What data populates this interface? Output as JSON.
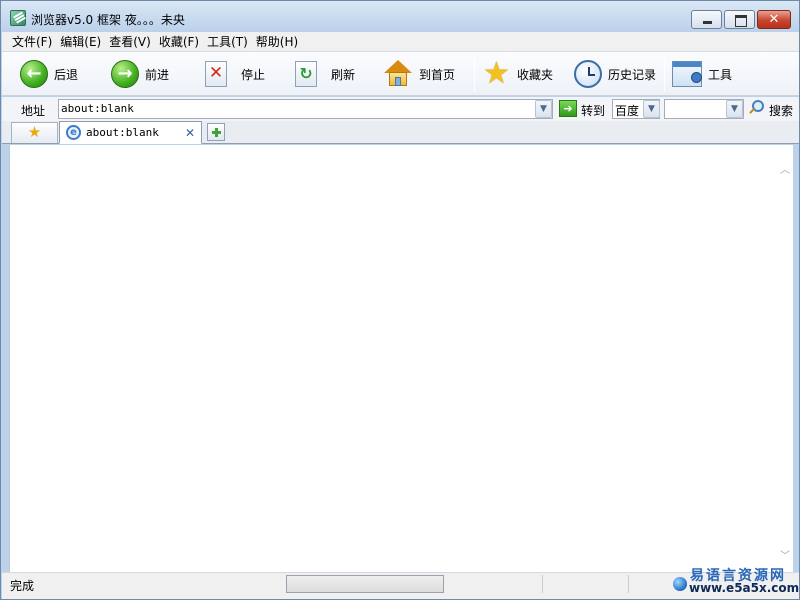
{
  "window": {
    "title": "浏览器v5.0 框架    夜。。。未央"
  },
  "menubar": {
    "items": [
      "文件(F)",
      "编辑(E)",
      "查看(V)",
      "收藏(F)",
      "工具(T)",
      "帮助(H)"
    ]
  },
  "toolbar": {
    "back_label": "后退",
    "forward_label": "前进",
    "stop_label": "停止",
    "refresh_label": "刷新",
    "home_label": "到首页",
    "favorites_label": "收藏夹",
    "history_label": "历史记录",
    "tools_label": "工具",
    "icons": {
      "back": "arrow-left-icon",
      "forward": "arrow-right-icon",
      "stop": "stop-icon",
      "refresh": "refresh-icon",
      "home": "home-icon",
      "favorites": "star-icon",
      "history": "clock-icon",
      "tools": "tools-icon"
    }
  },
  "addressbar": {
    "label": "地址",
    "url": "about:blank",
    "go_label": "转到",
    "search_engine": "百度",
    "search_query": "",
    "search_label": "搜索"
  },
  "tabs": {
    "items": [
      {
        "title": "about:blank",
        "active": true
      }
    ]
  },
  "statusbar": {
    "status_text": "完成",
    "progress": 0
  },
  "watermark": {
    "site_name": "易语言资源网",
    "site_url": "www.e5a5x.com"
  },
  "colors": {
    "titlebar": "#c6d9ef",
    "close_button": "#c8452d",
    "accent_green": "#3fae1e",
    "watermark_blue": "#2a67b7"
  }
}
